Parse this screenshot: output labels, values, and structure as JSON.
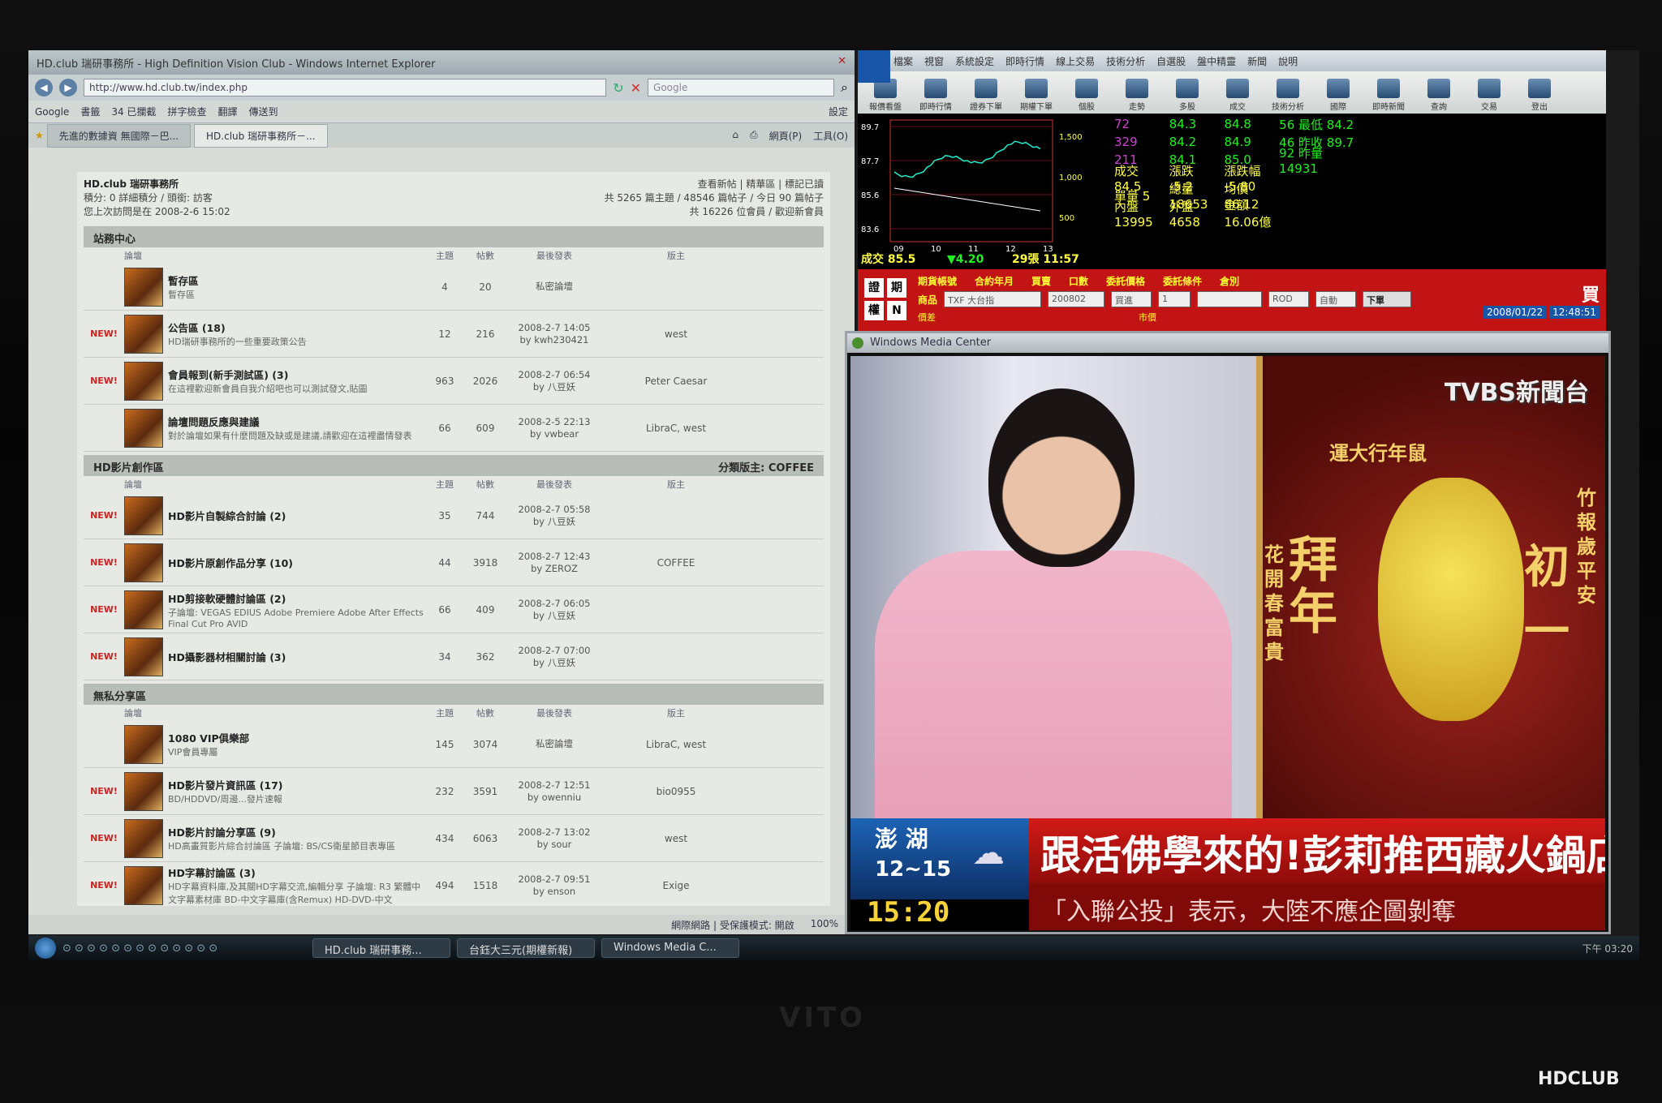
{
  "ie": {
    "title": "HD.club 瑞研事務所 - High Definition Vision Club - Windows Internet Explorer",
    "url": "http://www.hd.club.tw/index.php",
    "search_placeholder": "Google",
    "toolbar_items": [
      "Google",
      "書籤",
      "34 已攔截",
      "拼字檢查",
      "翻譯",
      "傳送到",
      "設定"
    ],
    "tabs": [
      "先進的數據資 無國際－巴...",
      "HD.club 瑞研事務所－..."
    ],
    "tab_tools": [
      "網頁(P)",
      "工具(O)"
    ],
    "status_zone": "網際網路 | 受保護模式: 開啟",
    "zoom": "100%"
  },
  "forum": {
    "site": "HD.club 瑞研事務所",
    "user_info": "積分: 0 詳細積分 / 頭銜: 訪客",
    "last_visit": "您上次訪問是在 2008-2-6 15:02",
    "links": "查看新帖 | 精華區 | 標記已讀",
    "stats": "共 5265 篇主題 / 48546 篇帖子 / 今日 90 篇帖子",
    "members": "共 16226 位會員 / 歡迎新會員",
    "col_headers": {
      "forum": "論壇",
      "topics": "主題",
      "posts": "帖數",
      "last": "最後發表",
      "mod": "版主"
    },
    "sections": [
      {
        "name": "站務中心",
        "mod_label": "",
        "rows": [
          {
            "new": "",
            "name": "暫存區",
            "desc": "暫存區",
            "topics": "4",
            "posts": "20",
            "last1": "私密論壇",
            "last2": "",
            "mod": ""
          },
          {
            "new": "NEW!",
            "name": "公告區 (18)",
            "desc": "HD瑞研事務所的一些重要政策公告",
            "topics": "12",
            "posts": "216",
            "last1": "2008-2-7 14:05",
            "last2": "by kwh230421",
            "mod": "west"
          },
          {
            "new": "NEW!",
            "name": "會員報到(新手測試區) (3)",
            "desc": "在這裡歡迎新會員自我介紹吧也可以測試發文,貼圖",
            "topics": "963",
            "posts": "2026",
            "last1": "2008-2-7 06:54",
            "last2": "by 八豆妖",
            "mod": "Peter Caesar"
          },
          {
            "new": "",
            "name": "論壇問題反應與建議",
            "desc": "對於論壇如果有什麼問題及缺或是建議,請歡迎在這裡盡情發表",
            "topics": "66",
            "posts": "609",
            "last1": "2008-2-5 22:13",
            "last2": "by vwbear",
            "mod": "LibraC, west"
          }
        ]
      },
      {
        "name": "HD影片創作區",
        "mod_label": "分類版主: COFFEE",
        "rows": [
          {
            "new": "NEW!",
            "name": "HD影片自製綜合討論 (2)",
            "desc": "",
            "topics": "35",
            "posts": "744",
            "last1": "2008-2-7 05:58",
            "last2": "by 八豆妖",
            "mod": ""
          },
          {
            "new": "NEW!",
            "name": "HD影片原創作品分享 (10)",
            "desc": "",
            "topics": "44",
            "posts": "3918",
            "last1": "2008-2-7 12:43",
            "last2": "by ZEROZ",
            "mod": "COFFEE"
          },
          {
            "new": "NEW!",
            "name": "HD剪接軟硬體討論區 (2)",
            "desc": "子論壇: VEGAS EDIUS Adobe Premiere Adobe After Effects Final Cut Pro AVID",
            "topics": "66",
            "posts": "409",
            "last1": "2008-2-7 06:05",
            "last2": "by 八豆妖",
            "mod": ""
          },
          {
            "new": "NEW!",
            "name": "HD攝影器材相關討論 (3)",
            "desc": "",
            "topics": "34",
            "posts": "362",
            "last1": "2008-2-7 07:00",
            "last2": "by 八豆妖",
            "mod": ""
          }
        ]
      },
      {
        "name": "無私分享區",
        "mod_label": "",
        "rows": [
          {
            "new": "",
            "name": "1080 VIP俱樂部",
            "desc": "VIP會員專屬",
            "topics": "145",
            "posts": "3074",
            "last1": "私密論壇",
            "last2": "",
            "mod": "LibraC, west"
          },
          {
            "new": "NEW!",
            "name": "HD影片發片資訊區 (17)",
            "desc": "BD/HDDVD/周邊...發片速報",
            "topics": "232",
            "posts": "3591",
            "last1": "2008-2-7 12:51",
            "last2": "by owenniu",
            "mod": "bio0955"
          },
          {
            "new": "NEW!",
            "name": "HD影片討論分享區 (9)",
            "desc": "HD高畫質影片綜合討論區 子論壇: BS/CS衛星節目表專區",
            "topics": "434",
            "posts": "6063",
            "last1": "2008-2-7 13:02",
            "last2": "by sour",
            "mod": "west"
          },
          {
            "new": "NEW!",
            "name": "HD字幕討論區 (3)",
            "desc": "HD字幕資料庫,及其關HD字幕交流,編輯分享 子論壇: R3 繁體中文字幕素材庫 BD-中文字幕庫(含Remux) HD-DVD-中文",
            "topics": "494",
            "posts": "1518",
            "last1": "2008-2-7 09:51",
            "last2": "by enson",
            "mod": "Exige"
          }
        ]
      }
    ]
  },
  "stock": {
    "menu": [
      "檔案",
      "視窗",
      "系統設定",
      "即時行情",
      "線上交易",
      "技術分析",
      "自選股",
      "盤中精靈",
      "新聞",
      "說明"
    ],
    "buttons": [
      "報價看盤",
      "即時行情",
      "證券下單",
      "期權下單",
      "個股",
      "走勢",
      "多股",
      "成交",
      "技術分析",
      "國際",
      "即時新聞",
      "查詢",
      "交易",
      "登出"
    ],
    "chart_y": [
      "89.7",
      "87.7",
      "85.6",
      "83.6"
    ],
    "chart_y2": [
      "1,500",
      "1,000",
      "500"
    ],
    "chart_x": [
      "09",
      "10",
      "11",
      "12",
      "13"
    ],
    "last_price": "成交 85.5",
    "change": "▼4.20",
    "volume_time": "29張 11:57",
    "quotes": [
      [
        "72",
        "84.3",
        "84.8",
        "56 最低 84.2"
      ],
      [
        "329",
        "84.2",
        "84.9",
        "46 昨收 89.7"
      ],
      [
        "211",
        "84.1",
        "85.0",
        "92 昨量 14931"
      ],
      [
        "成交 84.5",
        "漲跌 -5.2",
        "漲跌幅 -5.80",
        ""
      ],
      [
        "單量 5",
        "總量 18653",
        "均價 86.12",
        ""
      ],
      [
        "內盤 13995",
        "外盤 4658",
        "金額 16.06億",
        ""
      ]
    ],
    "order": {
      "labels": [
        "期貨帳號",
        "合約年月",
        "買賣",
        "口數",
        "委託價格",
        "委託條件",
        "倉別"
      ],
      "product_label": "商品",
      "product": "TXF 大台指",
      "month": "200802",
      "side": "買進",
      "qty": "1",
      "cond": "ROD",
      "pos": "自動",
      "submit": "下單",
      "checks": [
        "價差",
        "市價"
      ],
      "side_tag": "買",
      "date": "2008/01/22",
      "time": "12:48:51",
      "left_keys": [
        "證",
        "期",
        "權",
        "N"
      ]
    }
  },
  "wmc": {
    "title": "Windows Media Center",
    "channel_logo": "TVBS新聞台",
    "banners": [
      "運大行年鼠",
      "拜年",
      "初一",
      "竹報歲平安",
      "花開春富貴"
    ],
    "location": "澎 湖",
    "temp": "12~15",
    "clock": "15:20",
    "headline": "跟活佛學來的!彭莉推西藏火鍋店",
    "ticker": "「入聯公投」表示，大陸不應企圖剝奪"
  },
  "taskbar": {
    "tasks": [
      "HD.club 瑞研事務...",
      "台鈺大三元(期權新報)",
      "Windows Media C..."
    ],
    "clock": "下午 03:20"
  },
  "brand": "VITO",
  "watermark": "HDCLUB"
}
